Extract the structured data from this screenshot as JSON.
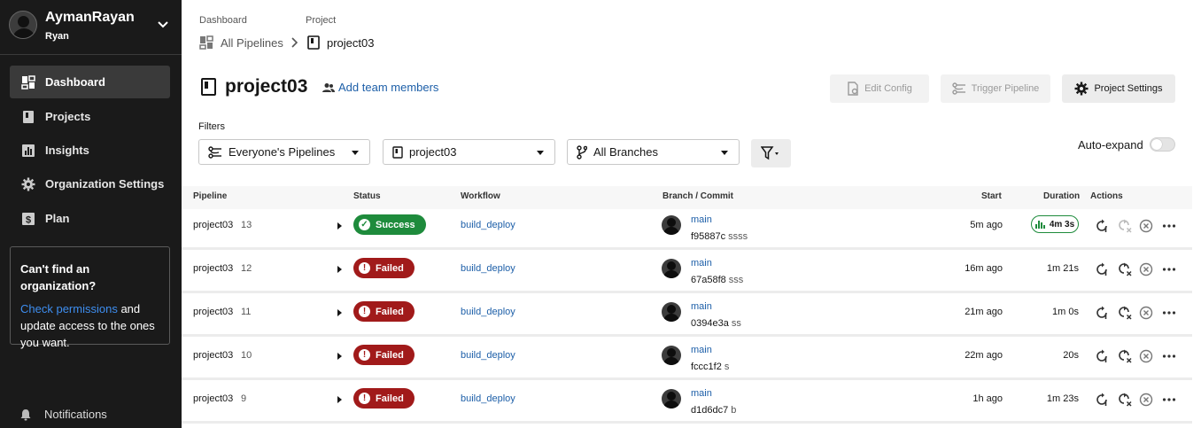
{
  "sidebar": {
    "user_name": "AymanRayan",
    "user_sub": "Ryan",
    "nav": [
      {
        "label": "Dashboard",
        "icon": "dashboard-icon",
        "active": true
      },
      {
        "label": "Projects",
        "icon": "project-icon"
      },
      {
        "label": "Insights",
        "icon": "insights-icon"
      },
      {
        "label": "Organization Settings",
        "icon": "gear-icon"
      },
      {
        "label": "Plan",
        "icon": "dollar-icon"
      }
    ],
    "org_box": {
      "title": "Can't find an organization?",
      "link": "Check permissions",
      "text_after_link": " and update access to the ones you want."
    },
    "notifications": "Notifications"
  },
  "breadcrumb": {
    "dashboard_label": "Dashboard",
    "dashboard_value": "All Pipelines",
    "project_label": "Project",
    "project_value": "project03"
  },
  "header": {
    "title": "project03",
    "add_team": "Add team members",
    "edit_config": "Edit Config",
    "trigger_pipeline": "Trigger Pipeline",
    "project_settings": "Project Settings"
  },
  "filters": {
    "label": "Filters",
    "pipelines": "Everyone's Pipelines",
    "project": "project03",
    "branches": "All Branches",
    "auto_expand": "Auto-expand"
  },
  "table": {
    "headers": {
      "pipeline": "Pipeline",
      "status": "Status",
      "workflow": "Workflow",
      "branch_commit": "Branch / Commit",
      "start": "Start",
      "duration": "Duration",
      "actions": "Actions"
    },
    "rows": [
      {
        "project": "project03",
        "number": "13",
        "status": "Success",
        "workflow": "build_deploy",
        "branch": "main",
        "commit": "f95887c",
        "message": "ssss",
        "start": "5m ago",
        "duration": "4m 3s"
      },
      {
        "project": "project03",
        "number": "12",
        "status": "Failed",
        "workflow": "build_deploy",
        "branch": "main",
        "commit": "67a58f8",
        "message": "sss",
        "start": "16m ago",
        "duration": "1m 21s"
      },
      {
        "project": "project03",
        "number": "11",
        "status": "Failed",
        "workflow": "build_deploy",
        "branch": "main",
        "commit": "0394e3a",
        "message": "ss",
        "start": "21m ago",
        "duration": "1m 0s"
      },
      {
        "project": "project03",
        "number": "10",
        "status": "Failed",
        "workflow": "build_deploy",
        "branch": "main",
        "commit": "fccc1f2",
        "message": "s",
        "start": "22m ago",
        "duration": "20s"
      },
      {
        "project": "project03",
        "number": "9",
        "status": "Failed",
        "workflow": "build_deploy",
        "branch": "main",
        "commit": "d1d6dc7",
        "message": "b",
        "start": "1h ago",
        "duration": "1m 23s"
      }
    ]
  },
  "colors": {
    "sidebar_bg": "#1a1a1a",
    "success": "#1e8b3c",
    "failed": "#a11a1a",
    "link": "#1d5fa8"
  }
}
